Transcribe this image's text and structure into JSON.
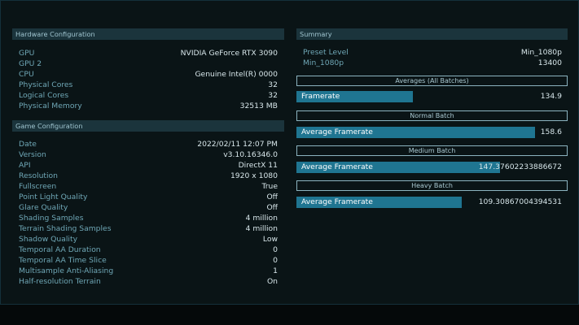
{
  "hardware": {
    "title": "Hardware Configuration",
    "rows": [
      {
        "label": "GPU",
        "value": "NVIDIA GeForce RTX 3090"
      },
      {
        "label": "GPU 2",
        "value": ""
      },
      {
        "label": "CPU",
        "value": "Genuine Intel(R) 0000"
      },
      {
        "label": "Physical Cores",
        "value": "32"
      },
      {
        "label": "Logical Cores",
        "value": "32"
      },
      {
        "label": "Physical Memory",
        "value": "32513 MB"
      }
    ]
  },
  "game": {
    "title": "Game Configuration",
    "rows": [
      {
        "label": "Date",
        "value": "2022/02/11 12:07 PM"
      },
      {
        "label": "Version",
        "value": "v3.10.16346.0"
      },
      {
        "label": "API",
        "value": "DirectX 11"
      },
      {
        "label": "Resolution",
        "value": "1920 x 1080"
      },
      {
        "label": "Fullscreen",
        "value": "True"
      },
      {
        "label": "Point Light Quality",
        "value": "Off"
      },
      {
        "label": "Glare Quality",
        "value": "Off"
      },
      {
        "label": "Shading Samples",
        "value": "4 million"
      },
      {
        "label": "Terrain Shading Samples",
        "value": "4 million"
      },
      {
        "label": "Shadow Quality",
        "value": "Low"
      },
      {
        "label": "Temporal AA Duration",
        "value": "0"
      },
      {
        "label": "Temporal AA Time Slice",
        "value": "0"
      },
      {
        "label": "Multisample Anti-Aliasing",
        "value": "1"
      },
      {
        "label": "Half-resolution Terrain",
        "value": "On"
      }
    ]
  },
  "summary": {
    "title": "Summary",
    "preset_label": "Preset Level",
    "preset_value": "Min_1080p",
    "score_label": "Min_1080p",
    "score_value": "13400",
    "all_batches_label": "Averages (All Batches)",
    "framerate_label": "Framerate",
    "framerate_value": "134.9",
    "framerate_fill": 0.43,
    "batches": [
      {
        "name": "Normal Batch",
        "bar_label": "Average Framerate",
        "value": "158.6",
        "fill": 0.88
      },
      {
        "name": "Medium Batch",
        "bar_label": "Average Framerate",
        "value": "147.37602233886672",
        "fill": 0.75
      },
      {
        "name": "Heavy Batch",
        "bar_label": "Average Framerate",
        "value": "109.30867004394531",
        "fill": 0.61
      }
    ]
  },
  "colors": {
    "background": "#0a1416",
    "header": "#1b343c",
    "bar": "#1f7591",
    "label": "#6fa7b6",
    "value": "#d7e6ea"
  }
}
